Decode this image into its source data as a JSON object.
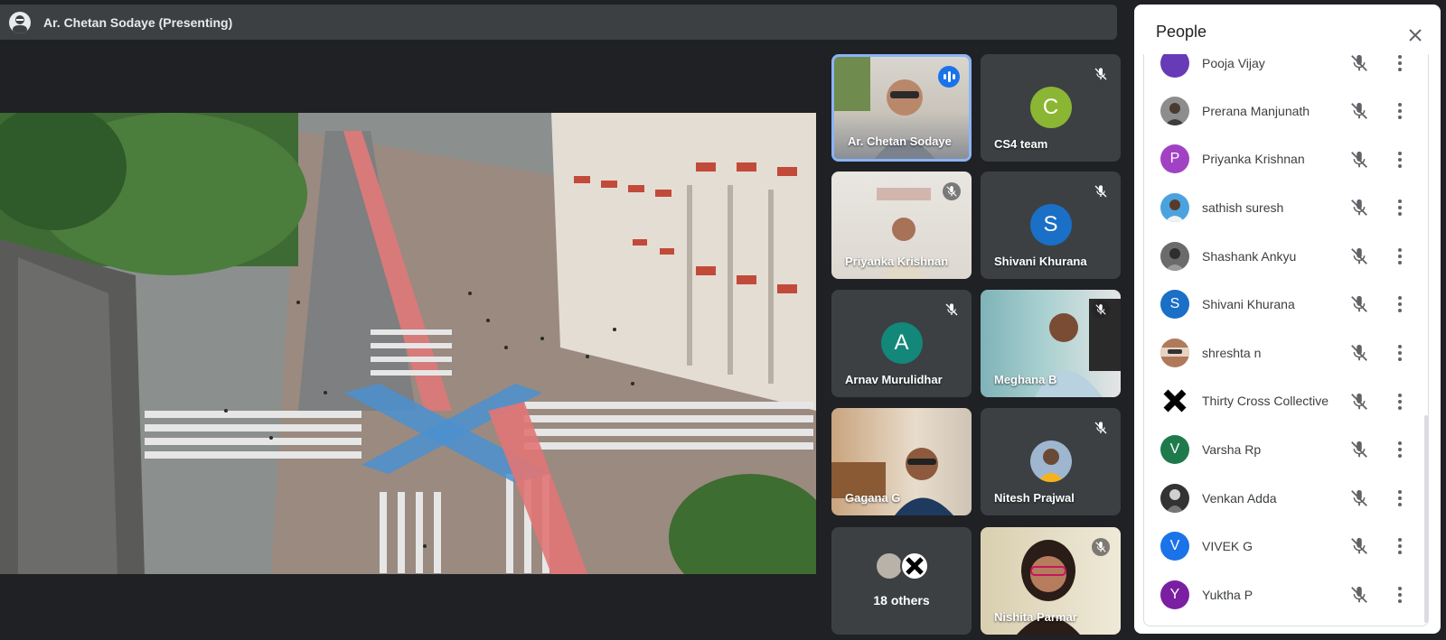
{
  "presenting": {
    "title": "Ar. Chetan Sodaye (Presenting)"
  },
  "tiles": [
    {
      "name": "Ar. Chetan Sodaye",
      "kind": "video",
      "speaking": true
    },
    {
      "name": "CS4 team",
      "kind": "initial",
      "initial": "C",
      "color": "#8bb633",
      "muted": true
    },
    {
      "name": "Priyanka Krishnan",
      "kind": "video",
      "muted": true
    },
    {
      "name": "Shivani Khurana",
      "kind": "initial",
      "initial": "S",
      "color": "#1a6fc6",
      "muted": true
    },
    {
      "name": "Arnav Murulidhar",
      "kind": "initial",
      "initial": "A",
      "color": "#12877a",
      "muted": true
    },
    {
      "name": "Meghana B",
      "kind": "video",
      "muted": true
    },
    {
      "name": "Gagana G",
      "kind": "video"
    },
    {
      "name": "Nitesh Prajwal",
      "kind": "photo",
      "muted": true
    },
    {
      "others_label": "18 others"
    },
    {
      "name": "Nishita Parmar",
      "kind": "video",
      "muted": true
    }
  ],
  "people_panel": {
    "title": "People",
    "partial_top_name": "Pooja Vijay",
    "participants": [
      {
        "name": "Prerana Manjunath",
        "avatar": "photo",
        "color": "#8d8d8d"
      },
      {
        "name": "Priyanka Krishnan",
        "avatar": "initial",
        "initial": "P",
        "color": "#a142c4"
      },
      {
        "name": "sathish suresh",
        "avatar": "photo",
        "color": "#4aa3df"
      },
      {
        "name": "Shashank Ankyu",
        "avatar": "photo",
        "color": "#6b6b6b"
      },
      {
        "name": "Shivani Khurana",
        "avatar": "initial",
        "initial": "S",
        "color": "#1a6fc6"
      },
      {
        "name": "shreshta n",
        "avatar": "photo",
        "color": "#b07a5a"
      },
      {
        "name": "Thirty Cross Collective",
        "avatar": "logo",
        "color": "#000000"
      },
      {
        "name": "Varsha Rp",
        "avatar": "initial",
        "initial": "V",
        "color": "#1e7a4a"
      },
      {
        "name": "Venkan Adda",
        "avatar": "photo",
        "color": "#333333"
      },
      {
        "name": "VIVEK G",
        "avatar": "initial",
        "initial": "V",
        "color": "#1a73e8"
      },
      {
        "name": "Yuktha P",
        "avatar": "initial",
        "initial": "Y",
        "color": "#7b1fa2"
      }
    ]
  }
}
